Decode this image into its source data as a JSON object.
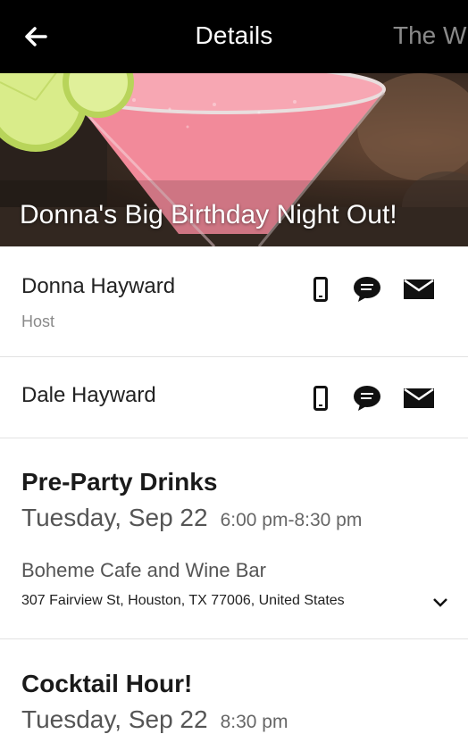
{
  "header": {
    "title": "Details",
    "next_screen_title": "The W",
    "back_icon": "arrow-left-icon"
  },
  "hero": {
    "event_name": "Donna's Big Birthday Night Out!",
    "image": "pink-cocktail-with-lime-photo"
  },
  "contacts": [
    {
      "name": "Donna Hayward",
      "role": "Host",
      "actions": [
        "phone-icon",
        "message-icon",
        "email-icon"
      ]
    },
    {
      "name": "Dale Hayward",
      "role": "",
      "actions": [
        "phone-icon",
        "message-icon",
        "email-icon"
      ]
    }
  ],
  "events": [
    {
      "title": "Pre-Party Drinks",
      "date": "Tuesday, Sep 22",
      "time": "6:00 pm-8:30 pm",
      "venue": "Boheme Cafe and Wine Bar",
      "address": "307 Fairview St, Houston, TX 77006, United States",
      "expand_icon": "chevron-down-icon"
    },
    {
      "title": "Cocktail Hour!",
      "date": "Tuesday, Sep 22",
      "time": "8:30 pm"
    }
  ],
  "colors": {
    "header_bg": "#000000",
    "header_text": "#ffffff",
    "divider": "#e2e2e2",
    "cocktail": "#f28a9a"
  }
}
